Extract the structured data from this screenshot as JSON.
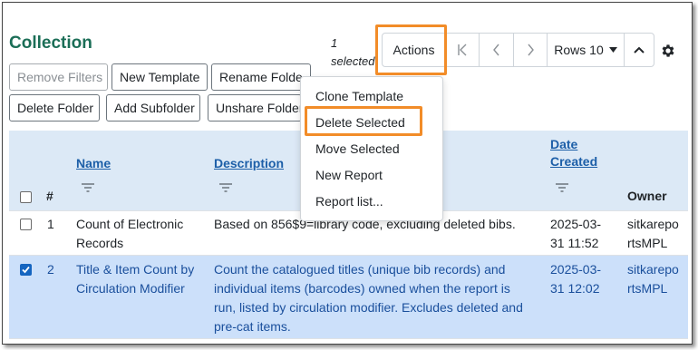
{
  "panel": {
    "title": "Collection"
  },
  "buttons": {
    "remove_filters": "Remove Filters",
    "new_template": "New Template",
    "rename_folder": "Rename Folde",
    "delete_folder": "Delete Folder",
    "add_subfolder": "Add Subfolder",
    "unshare_folder": "Unshare Folder"
  },
  "selection": {
    "count": "1",
    "label": "selected"
  },
  "toolbar": {
    "actions": "Actions",
    "first_icon": "first-page-icon",
    "prev_icon": "prev-page-icon",
    "next_icon": "next-page-icon",
    "rows": "Rows 10",
    "rows_caret_icon": "caret-down-icon",
    "collapse_icon": "chevron-up-icon",
    "settings_icon": "gear-icon"
  },
  "actions_menu": {
    "items": [
      "Clone Template",
      "Delete Selected",
      "Move Selected",
      "New Report",
      "Report list..."
    ],
    "highlighted": "Delete Selected"
  },
  "table": {
    "headers": {
      "index": "#",
      "name": "Name",
      "description": "Description",
      "date_line1": "Date",
      "date_line2": "Created",
      "owner": "Owner"
    },
    "rows": [
      {
        "checked": false,
        "index": "1",
        "name": [
          "Count of Electronic",
          "Records"
        ],
        "description": [
          "Based on 856$9=library code, excluding deleted bibs."
        ],
        "date": [
          "2025-03-",
          "31 11:52"
        ],
        "owner": [
          "sitkarepo",
          "rtsMPL"
        ]
      },
      {
        "checked": true,
        "index": "2",
        "name": [
          "Title & Item Count by",
          "Circulation Modifier"
        ],
        "description": [
          "Count the catalogued titles (unique bib records) and",
          "individual items (barcodes) owned when the report is",
          "run, listed by circulation modifier. Excludes deleted and",
          "pre-cat items."
        ],
        "date": [
          "2025-03-",
          "31 12:02"
        ],
        "owner": [
          "sitkarepo",
          "rtsMPL"
        ]
      }
    ]
  },
  "colors": {
    "title": "#1b6e57",
    "link": "#1d5fa8",
    "header_bg": "#dce9f6",
    "selected_row_bg": "#cce0fa",
    "highlight_outline": "#f28c28",
    "checkbox_checked": "#1565c0"
  }
}
